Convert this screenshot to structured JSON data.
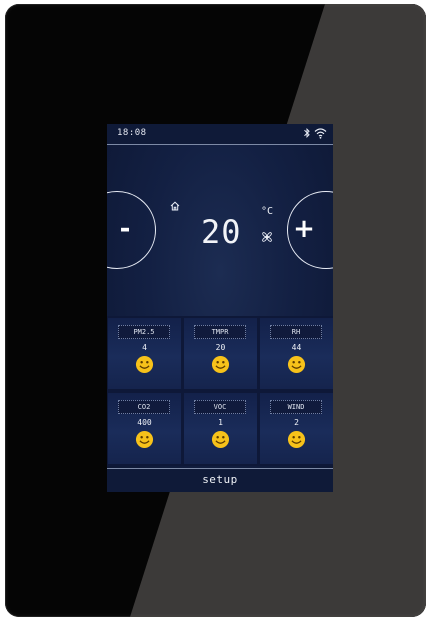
{
  "status_bar": {
    "time": "18:08",
    "icons": [
      "bluetooth-icon",
      "wifi-icon"
    ]
  },
  "thermostat": {
    "minus_label": "-",
    "plus_label": "+",
    "temperature": "20",
    "unit": "°C",
    "mode_icon": "home-icon",
    "fan_icon": "fan-icon"
  },
  "sensors": [
    {
      "label": "PM2.5",
      "value": "4",
      "status_icon": "smiley-icon"
    },
    {
      "label": "TMPR",
      "value": "20",
      "status_icon": "smiley-icon"
    },
    {
      "label": "RH",
      "value": "44",
      "status_icon": "smiley-icon"
    },
    {
      "label": "CO2",
      "value": "400",
      "status_icon": "smiley-icon"
    },
    {
      "label": "VOC",
      "value": "1",
      "status_icon": "smiley-icon"
    },
    {
      "label": "WIND",
      "value": "2",
      "status_icon": "smiley-icon"
    }
  ],
  "footer": {
    "setup_label": "setup"
  },
  "colors": {
    "screen_bg": "#132043",
    "smiley": "#f7c21a",
    "bezel": "#050505"
  }
}
